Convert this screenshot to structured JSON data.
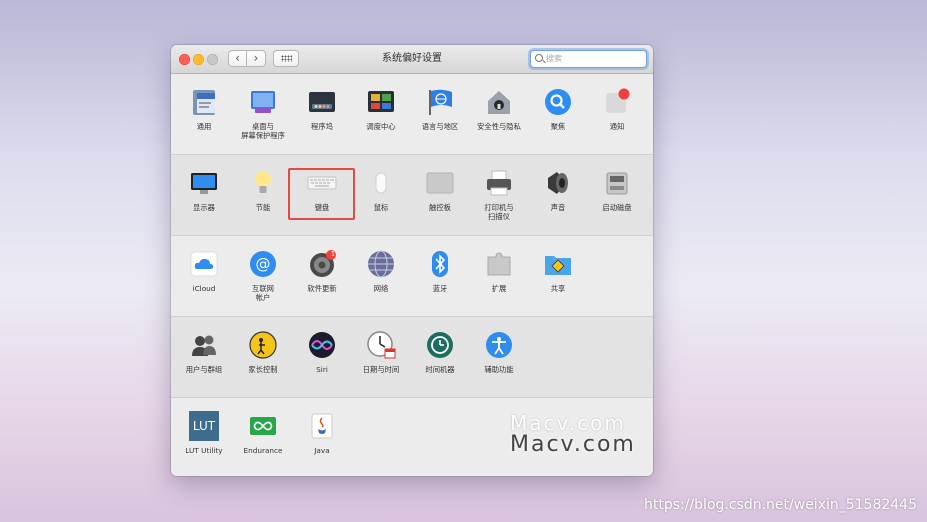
{
  "window": {
    "title": "系统偏好设置",
    "nav": {
      "back": "‹",
      "forward": "›"
    },
    "search": {
      "placeholder": "搜索"
    }
  },
  "rows": [
    [
      {
        "label": "通用",
        "icon": "file-icon"
      },
      {
        "label": "桌面与",
        "label2": "屏幕保护程序",
        "icon": "desktop-icon"
      },
      {
        "label": "程序坞",
        "icon": "dock-icon"
      },
      {
        "label": "调度中心",
        "icon": "mission-control-icon"
      },
      {
        "label": "语言与地区",
        "icon": "flag-icon"
      },
      {
        "label": "安全性与隐私",
        "icon": "house-lock-icon"
      },
      {
        "label": "聚焦",
        "icon": "spotlight-icon"
      },
      {
        "label": "通知",
        "icon": "notifications-icon"
      }
    ],
    [
      {
        "label": "显示器",
        "icon": "display-icon"
      },
      {
        "label": "节能",
        "icon": "bulb-icon"
      },
      {
        "label": "键盘",
        "icon": "keyboard-icon"
      },
      {
        "label": "鼠标",
        "icon": "mouse-icon"
      },
      {
        "label": "触控板",
        "icon": "trackpad-icon"
      },
      {
        "label": "打印机与",
        "label2": "扫描仪",
        "icon": "printer-icon"
      },
      {
        "label": "声音",
        "icon": "speaker-icon"
      },
      {
        "label": "启动磁盘",
        "icon": "disk-icon"
      }
    ],
    [
      {
        "label": "iCloud",
        "icon": "cloud-icon"
      },
      {
        "label": "互联网",
        "label2": "帐户",
        "icon": "at-icon"
      },
      {
        "label": "软件更新",
        "icon": "gear-icon",
        "badge": "1"
      },
      {
        "label": "网络",
        "icon": "globe-icon"
      },
      {
        "label": "蓝牙",
        "icon": "bluetooth-icon"
      },
      {
        "label": "扩展",
        "icon": "puzzle-icon"
      },
      {
        "label": "共享",
        "icon": "folder-share-icon"
      }
    ],
    [
      {
        "label": "用户与群组",
        "icon": "users-icon"
      },
      {
        "label": "家长控制",
        "icon": "parental-icon"
      },
      {
        "label": "Siri",
        "icon": "siri-icon"
      },
      {
        "label": "日期与时间",
        "icon": "clock-icon"
      },
      {
        "label": "时间机器",
        "icon": "time-machine-icon"
      },
      {
        "label": "辅助功能",
        "icon": "accessibility-icon"
      }
    ],
    [
      {
        "label": "LUT Utility",
        "icon": "lut-icon",
        "icon_text": "LUT"
      },
      {
        "label": "Endurance",
        "icon": "endurance-icon"
      },
      {
        "label": "Java",
        "icon": "java-icon"
      }
    ]
  ],
  "watermark": {
    "line1": "Macv.com",
    "line2": "Macv.com"
  },
  "footer_url": "https://blog.csdn.net/weixin_51582445",
  "colors": {
    "highlight": "#e24b43",
    "accent_blue": "#2f8cf0"
  }
}
